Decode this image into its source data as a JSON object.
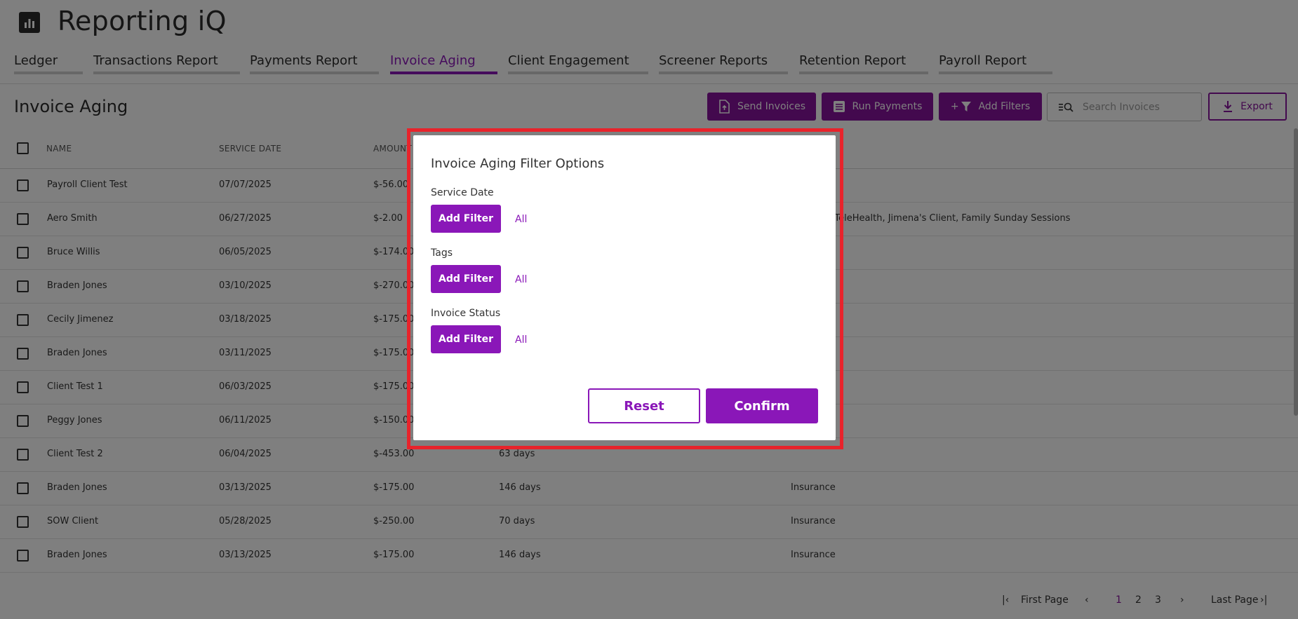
{
  "app": {
    "title": "Reporting iQ",
    "logo_icon": "bar-chart-icon"
  },
  "tabs": [
    {
      "label": "Ledger",
      "active": false
    },
    {
      "label": "Transactions Report",
      "active": false
    },
    {
      "label": "Payments Report",
      "active": false
    },
    {
      "label": "Invoice Aging",
      "active": true
    },
    {
      "label": "Client Engagement",
      "active": false
    },
    {
      "label": "Screener Reports",
      "active": false
    },
    {
      "label": "Retention Report",
      "active": false
    },
    {
      "label": "Payroll Report",
      "active": false
    }
  ],
  "toolbar": {
    "heading": "Invoice Aging",
    "send_invoices": "Send Invoices",
    "run_payments": "Run Payments",
    "add_filters": "Add Filters",
    "add_filters_prefix": "+",
    "search_placeholder": "Search Invoices",
    "export": "Export"
  },
  "table": {
    "headers": {
      "name": "NAME",
      "service_date": "SERVICE DATE",
      "amount": "AMOUNT"
    },
    "rows": [
      {
        "name": "Payroll Client Test",
        "service_date": "07/07/2025",
        "amount": "$-56.00",
        "age": "",
        "tags": ""
      },
      {
        "name": "Aero Smith",
        "service_date": "06/27/2025",
        "amount": "$-2.00",
        "age": "",
        "tags": "In Office, TeleHealth, Jimena's Client, Family Sunday Sessions"
      },
      {
        "name": "Bruce Willis",
        "service_date": "06/05/2025",
        "amount": "$-174.00",
        "age": "",
        "tags": ""
      },
      {
        "name": "Braden Jones",
        "service_date": "03/10/2025",
        "amount": "$-270.00",
        "age": "",
        "tags": ""
      },
      {
        "name": "Cecily Jimenez",
        "service_date": "03/18/2025",
        "amount": "$-175.00",
        "age": "",
        "tags": ""
      },
      {
        "name": "Braden Jones",
        "service_date": "03/11/2025",
        "amount": "$-175.00",
        "age": "",
        "tags": ""
      },
      {
        "name": "Client Test 1",
        "service_date": "06/03/2025",
        "amount": "$-175.00",
        "age": "",
        "tags": ""
      },
      {
        "name": "Peggy Jones",
        "service_date": "06/11/2025",
        "amount": "$-150.00",
        "age": "",
        "tags": ""
      },
      {
        "name": "Client Test 2",
        "service_date": "06/04/2025",
        "amount": "$-453.00",
        "age": "63 days",
        "tags": ""
      },
      {
        "name": "Braden Jones",
        "service_date": "03/13/2025",
        "amount": "$-175.00",
        "age": "146 days",
        "tags": "Insurance"
      },
      {
        "name": "SOW Client",
        "service_date": "05/28/2025",
        "amount": "$-250.00",
        "age": "70 days",
        "tags": "Insurance"
      },
      {
        "name": "Braden Jones",
        "service_date": "03/13/2025",
        "amount": "$-175.00",
        "age": "146 days",
        "tags": "Insurance"
      }
    ]
  },
  "pagination": {
    "first": "First Page",
    "last": "Last Page",
    "pages": [
      "1",
      "2",
      "3"
    ],
    "current": "1"
  },
  "modal": {
    "title": "Invoice Aging Filter Options",
    "sections": [
      {
        "label": "Service Date",
        "button": "Add Filter",
        "value": "All"
      },
      {
        "label": "Tags",
        "button": "Add Filter",
        "value": "All"
      },
      {
        "label": "Invoice Status",
        "button": "Add Filter",
        "value": "All"
      }
    ],
    "reset": "Reset",
    "confirm": "Confirm"
  },
  "colors": {
    "accent": "#8a17b8",
    "highlight": "#e8232b",
    "text": "#2b2b2b"
  }
}
